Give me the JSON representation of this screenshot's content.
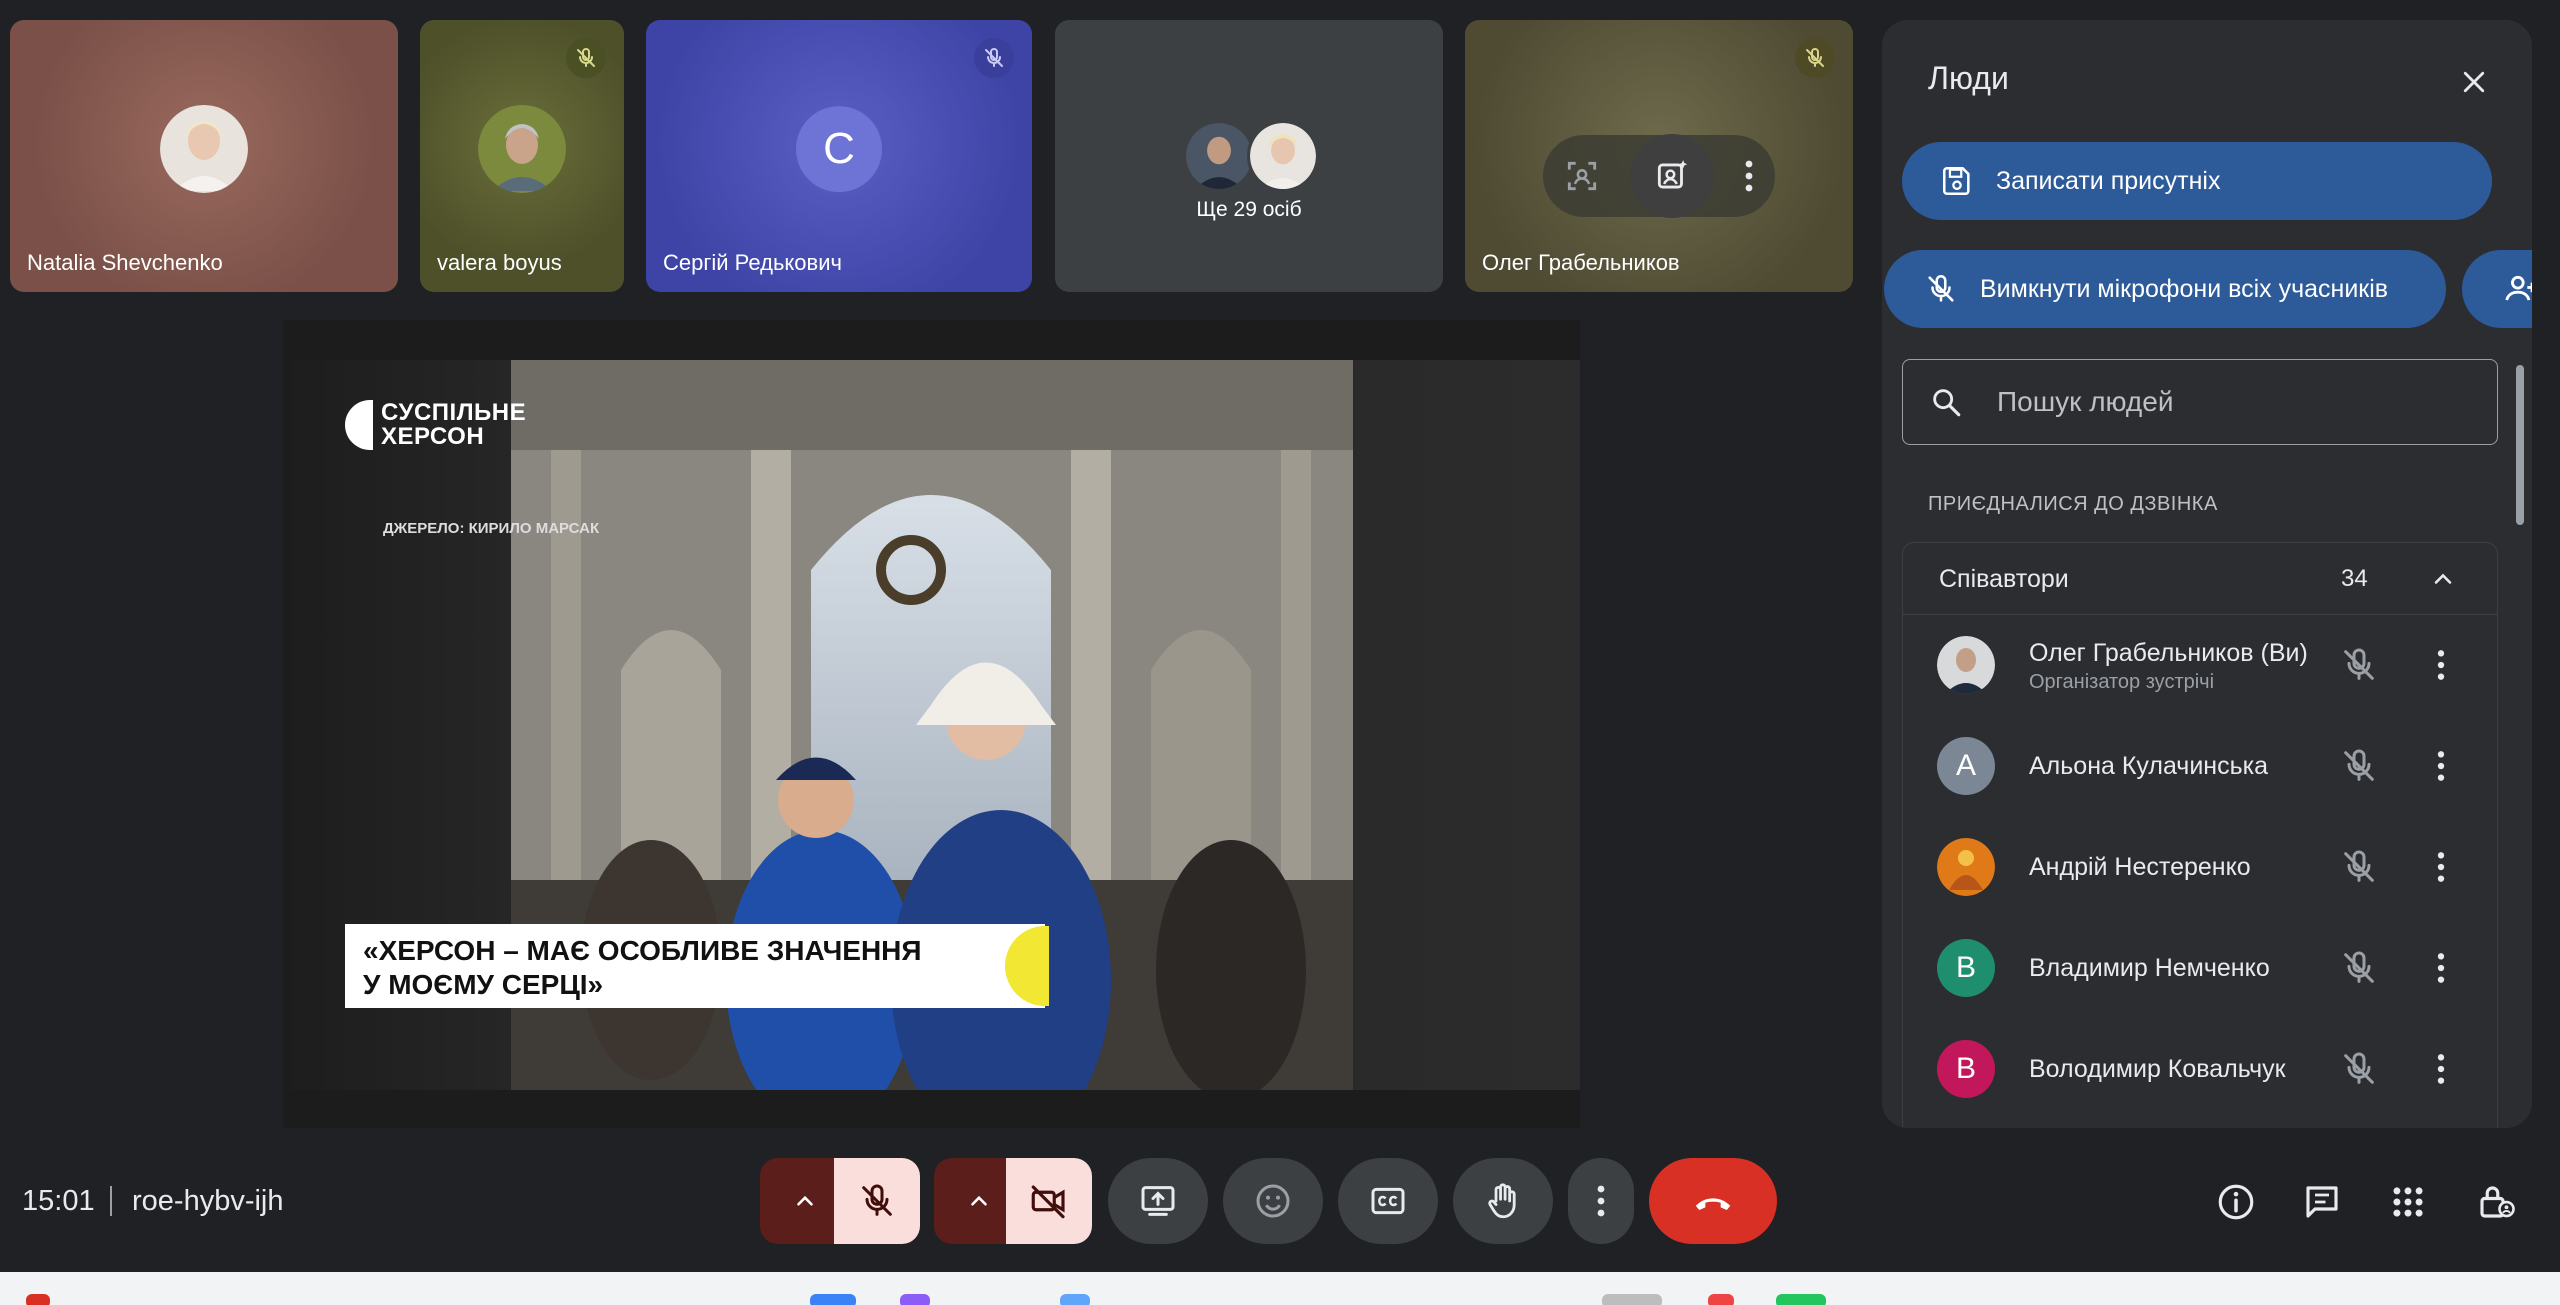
{
  "tiles": [
    {
      "name": "Natalia Shevchenko",
      "muted": false
    },
    {
      "name": "valera boyus",
      "muted": true
    },
    {
      "name": "Сергій Редькович",
      "initial": "С",
      "muted": true
    },
    {
      "more_label": "Ще 29 осіб"
    },
    {
      "name": "Олег Грабельников",
      "muted": true
    }
  ],
  "presentation": {
    "logo_line1": "СУСПІЛЬНЕ",
    "logo_line2": "ХЕРСОН",
    "source": "ДЖЕРЕЛО: КИРИЛО МАРСАК",
    "quote": "«ХЕРСОН – МАЄ ОСОБЛИВЕ ЗНАЧЕННЯ\nУ МОЄМУ СЕРЦІ»"
  },
  "panel": {
    "title": "Люди",
    "record_label": "Записати присутніх",
    "mute_all_label": "Вимкнути мікрофони всіх учасників",
    "search_placeholder": "Пошук людей",
    "section_label": "ПРИЄДНАЛИСЯ ДО ДЗВІНКА",
    "group_title": "Співавтори",
    "group_count": "34",
    "people": [
      {
        "name": "Олег Грабельников (Ви)",
        "role": "Організатор зустрічі",
        "avatar": "photo"
      },
      {
        "name": "Альона Кулачинська",
        "initial": "А",
        "color": "#7b8794"
      },
      {
        "name": "Андрій Нестеренко",
        "avatar": "photo"
      },
      {
        "name": "Владимир Немченко",
        "initial": "В",
        "color": "#1e8e6e"
      },
      {
        "name": "Володимир Ковальчук",
        "initial": "В",
        "color": "#c2185b"
      }
    ]
  },
  "bottom": {
    "time": "15:01",
    "meeting_code": "roe-hybv-ijh"
  },
  "colors": {
    "background": "#202124",
    "accent_pill": "#2d5a99",
    "leave_red": "#d93025",
    "muted_toggle": "#f9dedc"
  }
}
